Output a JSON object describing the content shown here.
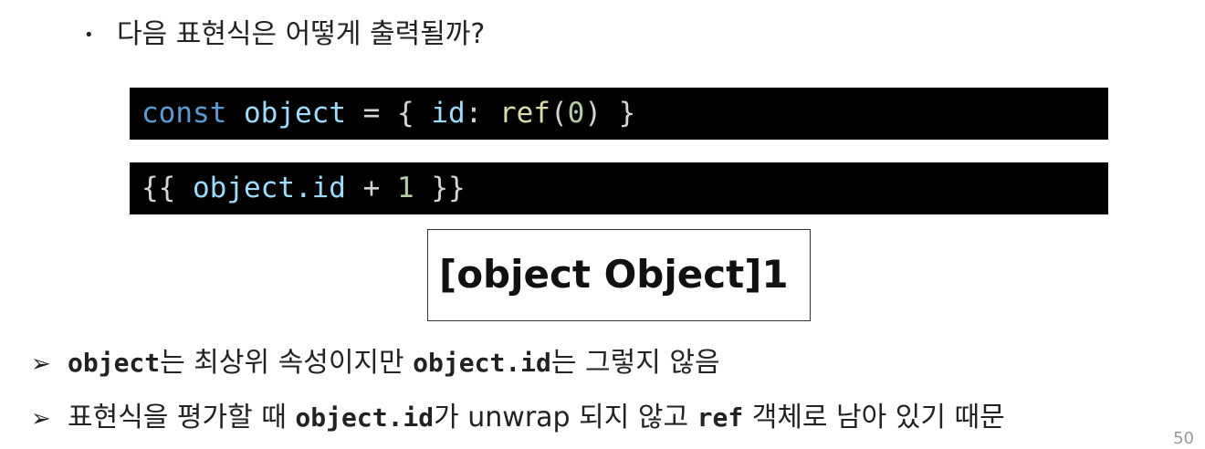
{
  "bullet": {
    "symbol": "•",
    "text": "다음 표현식은 어떻게 출력될까?"
  },
  "code1": {
    "kw": "const",
    "var": "object",
    "eq": " = { ",
    "key": "id",
    "colon": ": ",
    "fn": "ref",
    "lp": "(",
    "num": "0",
    "rp": ") }"
  },
  "code2": {
    "open": "{{ ",
    "expr": "object.id",
    "plus": " + ",
    "num": "1",
    "close": " }}"
  },
  "output": {
    "text": "[object Object]1"
  },
  "notes": [
    {
      "arrow": "➢",
      "code": "object",
      "text": "는 최상위 속성이지만 ",
      "code2": "object.id",
      "text2": "는 그렇지 않음"
    },
    {
      "arrow": "➢",
      "text0": "표현식을 평가할 때 ",
      "code": "object.id",
      "text": "가 unwrap 되지 않고 ",
      "code2": "ref",
      "text2": " 객체로 남아 있기 때문"
    }
  ],
  "page_number": "50"
}
